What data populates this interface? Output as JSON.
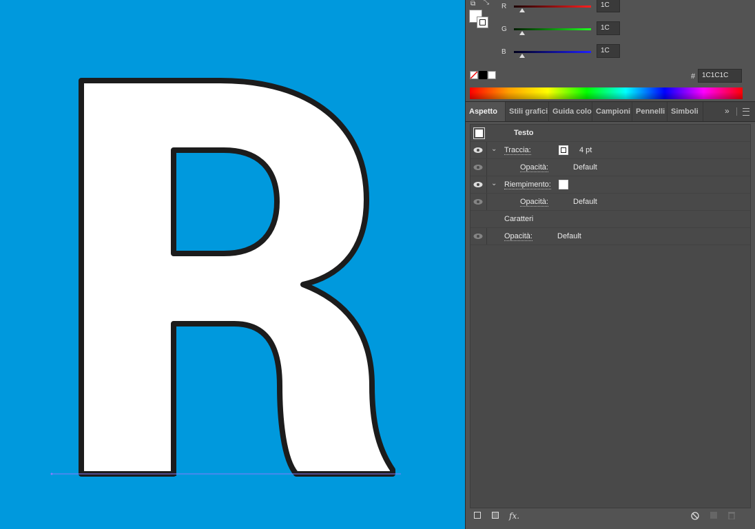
{
  "color_panel": {
    "sliders": [
      {
        "channel": "R",
        "value": "1C",
        "color_from": "#3a0000",
        "color_to": "#ff0000"
      },
      {
        "channel": "G",
        "value": "1C",
        "color_from": "#003a00",
        "color_to": "#00ff00"
      },
      {
        "channel": "B",
        "value": "1C",
        "color_from": "#00003a",
        "color_to": "#0000ff"
      }
    ],
    "hex_symbol": "#",
    "hex_value": "1C1C1C",
    "fill_color": "#ffffff",
    "stroke_color": "#1c1c1c"
  },
  "tabs": [
    {
      "label": "Aspetto",
      "active": true
    },
    {
      "label": "Stili grafici",
      "active": false
    },
    {
      "label": "Guida colori",
      "active": false
    },
    {
      "label": "Campioni",
      "active": false
    },
    {
      "label": "Pennelli",
      "active": false
    },
    {
      "label": "Simboli",
      "active": false
    }
  ],
  "appearance": {
    "object_type": "Testo",
    "rows": [
      {
        "label": "Traccia:",
        "value": "4 pt",
        "swatch": "stroke"
      },
      {
        "label": "Opacità:",
        "value": "Default"
      },
      {
        "label": "Riempimento:",
        "value": "",
        "swatch": "fill"
      },
      {
        "label": "Opacità:",
        "value": "Default"
      },
      {
        "label": "Caratteri",
        "value": ""
      },
      {
        "label": "Opacità:",
        "value": "Default"
      }
    ]
  },
  "toolbar_icons": [
    "new-stroke-icon",
    "new-fill-icon",
    "fx-icon",
    "clear-appearance-icon",
    "duplicate-item-icon",
    "delete-item-icon"
  ],
  "fx_label": "fx.",
  "canvas": {
    "background": "#0099dd",
    "glyph": "R",
    "glyph_fill": "#ffffff",
    "glyph_stroke": "#1c1c1c"
  }
}
